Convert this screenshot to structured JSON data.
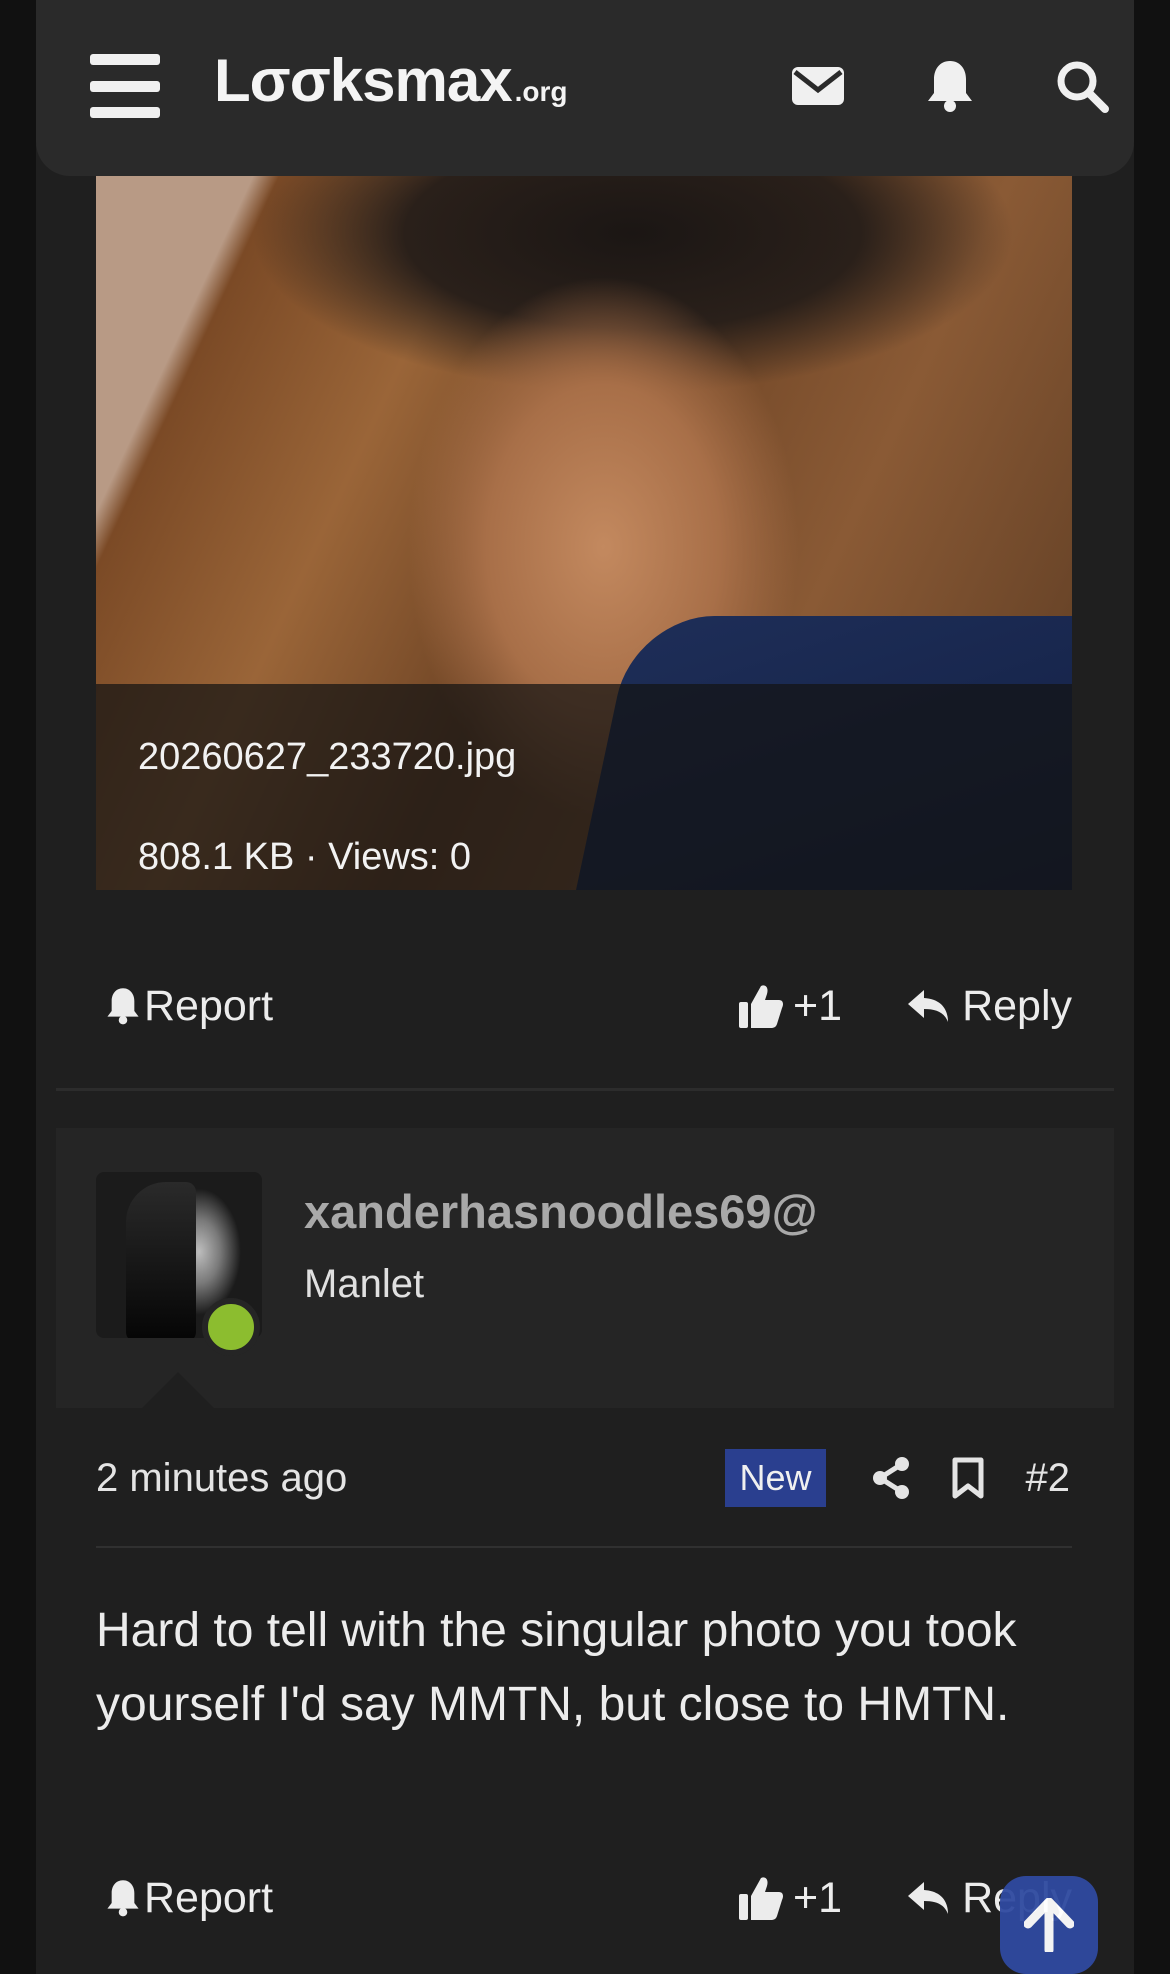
{
  "header": {
    "logo_main": "Lσσksmax",
    "logo_tld": ".org"
  },
  "attachment": {
    "filename": "20260627_233720.jpg",
    "meta": "808.1 KB · Views: 0"
  },
  "post1_actions": {
    "report": "Report",
    "like": "+1",
    "reply": "Reply"
  },
  "post2": {
    "username": "xanderhasnoodles69@",
    "user_title": "Manlet",
    "time": "2 minutes ago",
    "badge": "New",
    "number": "#2",
    "message": "Hard to tell with the singular photo you took yourself I'd say MMTN, but close to HMTN.",
    "actions": {
      "report": "Report",
      "like": "+1",
      "reply": "Reply"
    }
  },
  "colors": {
    "background": "#1f1f1f",
    "topbar": "#2a2a2a",
    "badge_new": "#2a3f8f",
    "online": "#8cbd2f",
    "scroll_top": "#2f4aa0"
  }
}
